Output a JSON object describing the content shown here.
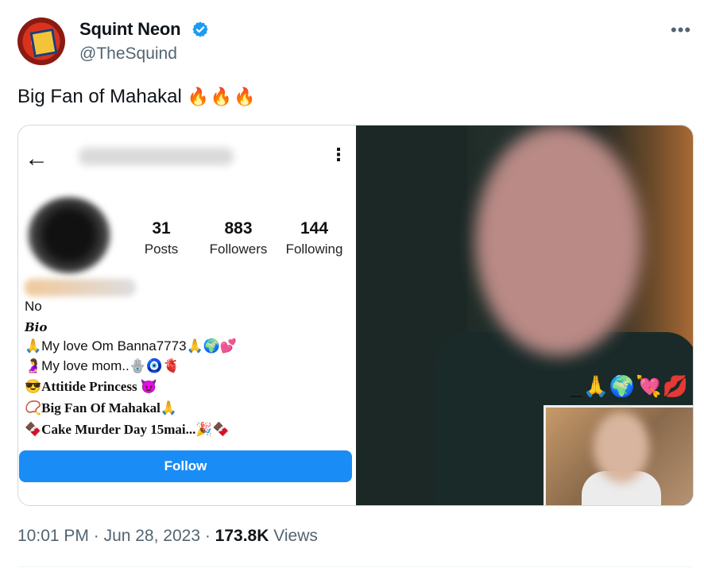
{
  "author": {
    "name": "Squint Neon",
    "handle": "@TheSquind",
    "verified": true
  },
  "tweet": {
    "text": "Big Fan of Mahakal",
    "emojis": "🔥🔥🔥"
  },
  "embedded_profile": {
    "stats": [
      {
        "value": "31",
        "label": "Posts"
      },
      {
        "value": "883",
        "label": "Followers"
      },
      {
        "value": "144",
        "label": "Following"
      }
    ],
    "name_line": "No",
    "bio_heading": "Bio",
    "bio_lines": [
      "🙏My love Om Banna7773🙏🌍💕",
      "🤰My love mom..🪬🧿🫀",
      "😎Attitide Princess 😈",
      "📿Big Fan Of  Mahakal🙏",
      "🍫Cake Murder Day 15mai...🎉🍫"
    ],
    "follow_label": "Follow"
  },
  "photo": {
    "emoji_overlay": "_🙏🌍💘💋"
  },
  "meta": {
    "time": "10:01 PM",
    "date": "Jun 28, 2023",
    "views_count": "173.8K",
    "views_label": "Views"
  },
  "colors": {
    "verified": "#1d9bf0",
    "follow_button": "#1a8cf5",
    "secondary_text": "#536471"
  },
  "icons": [
    "verified-badge-icon",
    "more-icon",
    "back-arrow-icon",
    "kebab-icon"
  ]
}
